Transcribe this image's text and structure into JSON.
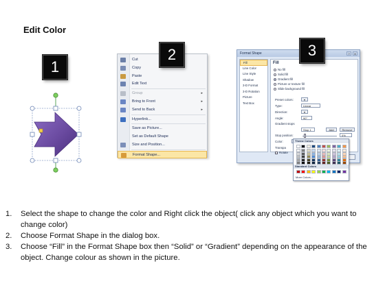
{
  "title": "Edit Color",
  "badges": [
    "1",
    "2",
    "3"
  ],
  "context_menu": {
    "items": [
      {
        "label": "Cut",
        "icon": "scissors-icon",
        "color": "#6b7fa8",
        "disabled": false,
        "submenu": false
      },
      {
        "label": "Copy",
        "icon": "copy-icon",
        "color": "#7a8db5",
        "disabled": false,
        "submenu": false
      },
      {
        "label": "Paste",
        "icon": "paste-icon",
        "color": "#c99a42",
        "disabled": false,
        "submenu": false
      },
      {
        "label": "Edit Text",
        "icon": "edit-text-icon",
        "color": "#6d83b0",
        "disabled": false,
        "submenu": false
      },
      {
        "label": "Group",
        "icon": "group-icon",
        "color": "#b8bec8",
        "disabled": true,
        "submenu": true
      },
      {
        "label": "Bring to Front",
        "icon": "bring-to-front-icon",
        "color": "#6a86c4",
        "disabled": false,
        "submenu": true
      },
      {
        "label": "Send to Back",
        "icon": "send-to-back-icon",
        "color": "#6a86c4",
        "disabled": false,
        "submenu": true
      },
      {
        "label": "Hyperlink...",
        "icon": "hyperlink-icon",
        "color": "#3d6fbf",
        "disabled": false,
        "submenu": false
      },
      {
        "label": "Save as Picture...",
        "icon": "",
        "color": "",
        "disabled": false,
        "submenu": false
      },
      {
        "label": "Set as Default Shape",
        "icon": "",
        "color": "",
        "disabled": false,
        "submenu": false
      },
      {
        "label": "Size and Position...",
        "icon": "size-position-icon",
        "color": "#7c8fb8",
        "disabled": false,
        "submenu": false
      },
      {
        "label": "Format Shape...",
        "icon": "format-shape-icon",
        "color": "#d79b3b",
        "disabled": false,
        "submenu": false,
        "highlighted": true
      }
    ]
  },
  "dialog": {
    "title": "Format Shape",
    "controls": [
      "?",
      "X"
    ],
    "nav": [
      "Fill",
      "Line Color",
      "Line Style",
      "Shadow",
      "3-D Format",
      "3-D Rotation",
      "Picture",
      "Text Box"
    ],
    "fill_header": "Fill",
    "fill_options": [
      {
        "label": "No fill",
        "selected": false
      },
      {
        "label": "Solid fill",
        "selected": false
      },
      {
        "label": "Gradient fill",
        "selected": true
      },
      {
        "label": "Picture or texture fill",
        "selected": false
      },
      {
        "label": "Slide background fill",
        "selected": false
      }
    ],
    "preset_label": "Preset colors:",
    "type_label": "Type:",
    "type_value": "Linear",
    "direction_label": "Direction:",
    "angle_label": "Angle:",
    "angle_value": "90°",
    "gradient_stops_label": "Gradient stops",
    "stop_value": "Stop 1",
    "add_label": "Add",
    "remove_label": "Remove",
    "stop_position_label": "Stop position:",
    "stop_position_value": "0%",
    "color_label": "Color:",
    "transparency_label": "Transpa",
    "rotate_label": "Rotate",
    "close_label": "Close"
  },
  "palette": {
    "theme_header": "Theme Colors",
    "standard_header": "Standard Colors",
    "more_label": "More Colors...",
    "theme_top": [
      "#ffffff",
      "#000000",
      "#eeece1",
      "#1f497d",
      "#4f81bd",
      "#c0504d",
      "#9bbb59",
      "#8064a2",
      "#4bacc6",
      "#f79646"
    ],
    "theme_rows": [
      [
        "#f2f2f2",
        "#7f7f7f",
        "#ddd9c3",
        "#c6d9f0",
        "#dbe5f1",
        "#f2dcdb",
        "#ebf1dd",
        "#e5e0ec",
        "#dbeef3",
        "#fdeada"
      ],
      [
        "#d8d8d8",
        "#595959",
        "#c4bd97",
        "#8db3e2",
        "#b8cce4",
        "#e5b9b7",
        "#d7e3bc",
        "#ccc1d9",
        "#b7dde8",
        "#fbd5b5"
      ],
      [
        "#bfbfbf",
        "#3f3f3f",
        "#938953",
        "#548dd4",
        "#95b3d7",
        "#d99694",
        "#c3d69b",
        "#b2a2c7",
        "#92cddc",
        "#fac08f"
      ],
      [
        "#a5a5a5",
        "#262626",
        "#494429",
        "#17365d",
        "#366092",
        "#953734",
        "#76923c",
        "#5f497a",
        "#31859b",
        "#e36c09"
      ],
      [
        "#7f7f7f",
        "#0c0c0c",
        "#1d1b10",
        "#0f243e",
        "#244061",
        "#632423",
        "#4f6128",
        "#3f3151",
        "#205867",
        "#974806"
      ]
    ],
    "standard": [
      "#c00000",
      "#ff0000",
      "#ffc000",
      "#ffff00",
      "#92d050",
      "#00b050",
      "#00b0f0",
      "#0070c0",
      "#002060",
      "#7030a0"
    ]
  },
  "arrow_color": "#6a4aa0",
  "instructions": [
    {
      "num": "1.",
      "text": "Select the shape to change the color and Right click the object( click any object which you want to change color)"
    },
    {
      "num": "2.",
      "text": "Choose Format Shape in the dialog box."
    },
    {
      "num": "3.",
      "text": "Choose “Fill” in the Format Shape box then “Solid” or “Gradient” depending on the appearance of the object. Change colour as shown in the picture."
    }
  ]
}
